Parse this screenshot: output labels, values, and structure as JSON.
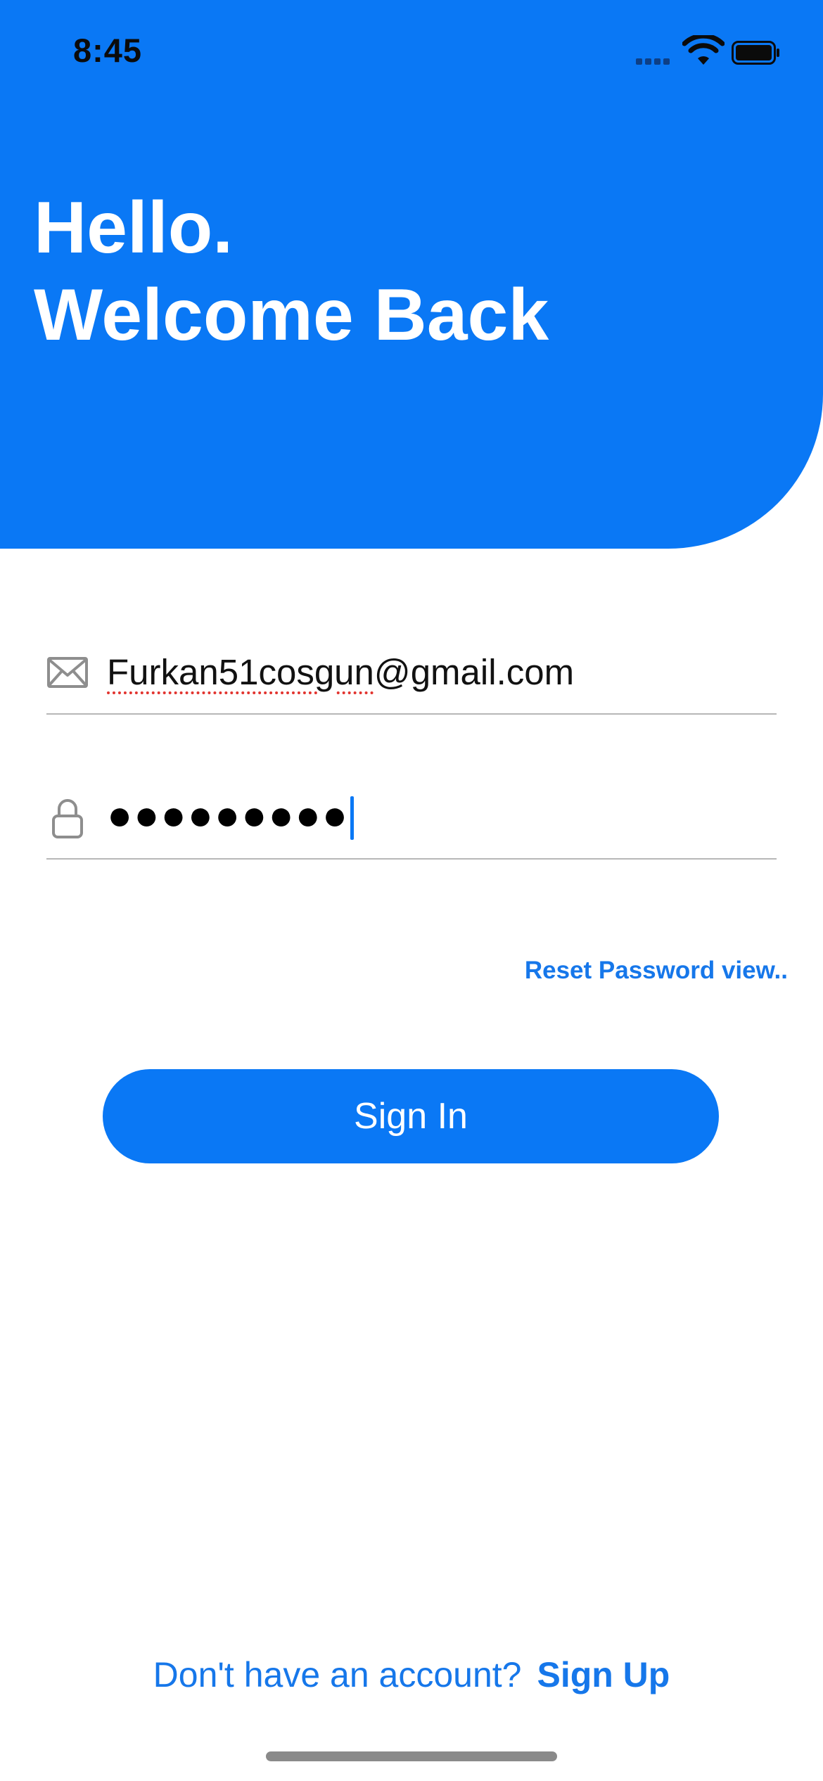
{
  "status_bar": {
    "time": "8:45",
    "signal_icon": "signal-icon",
    "wifi_icon": "wifi-icon",
    "battery_icon": "battery-icon"
  },
  "header": {
    "line1": "Hello.",
    "line2": "Welcome Back",
    "background_color": "#0a78f5"
  },
  "form": {
    "email": {
      "icon": "mail-icon",
      "value_misspelled_part": "Furkan51cosgun",
      "value_rest": "@gmail.com"
    },
    "password": {
      "icon": "lock-icon",
      "masked_value": "●●●●●●●●●"
    },
    "reset_password_label": "Reset Password view..",
    "sign_in_label": "Sign In"
  },
  "footer": {
    "prompt": "Don't have an account?",
    "sign_up_label": "Sign Up"
  },
  "colors": {
    "accent": "#0a78f5",
    "link": "#1677ea",
    "divider": "#b7b7b7"
  }
}
